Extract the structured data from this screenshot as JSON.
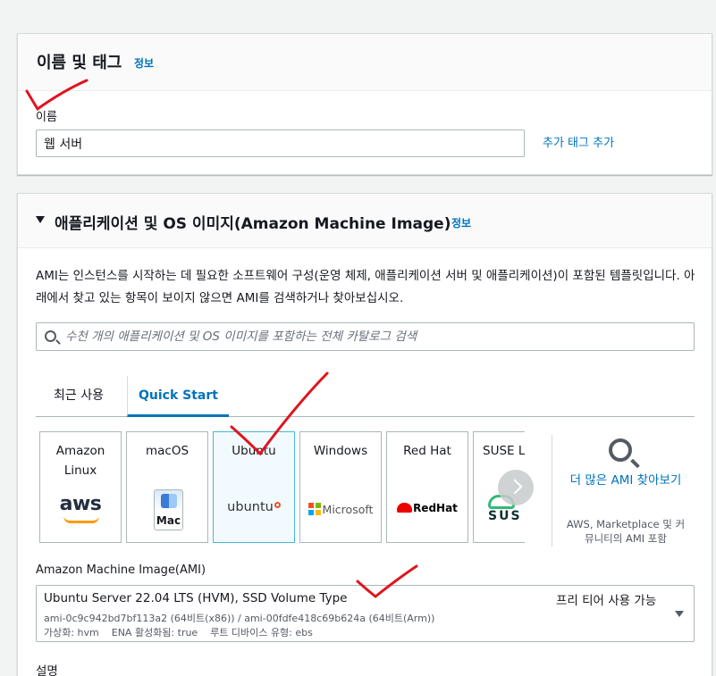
{
  "name_section": {
    "title": "이름 및 태그",
    "info": "정보",
    "name_label": "이름",
    "name_value": "웹 서버",
    "add_tag": "추가 태그 추가"
  },
  "ami_section": {
    "title": "애플리케이션 및 OS 이미지(Amazon Machine Image)",
    "info": "정보",
    "description": "AMI는 인스턴스를 시작하는 데 필요한 소프트웨어 구성(운영 체제, 애플리케이션 서버 및 애플리케이션)이 포함된 템플릿입니다. 아래에서 찾고 있는 항목이 보이지 않으면 AMI를 검색하거나 찾아보십시오.",
    "search_placeholder": "수천 개의 애플리케이션 및 OS 이미지를 포함하는 전체 카탈로그 검색",
    "tabs": [
      {
        "label": "최근 사용",
        "active": false
      },
      {
        "label": "Quick Start",
        "active": true
      }
    ],
    "os_options": [
      {
        "name": "Amazon Linux",
        "logo": "aws"
      },
      {
        "name": "macOS",
        "logo": "Mac"
      },
      {
        "name": "Ubuntu",
        "logo": "ubuntu",
        "selected": true
      },
      {
        "name": "Windows",
        "logo": "Microsoft"
      },
      {
        "name": "Red Hat",
        "logo": "RedHat"
      },
      {
        "name": "SUSE Li",
        "logo": "SUS"
      }
    ],
    "more_ami": {
      "link": "더 많은 AMI 찾아보기",
      "desc": "AWS, Marketplace 및 커뮤니티의 AMI 포함"
    },
    "ami_label": "Amazon Machine Image(AMI)",
    "selected_ami": {
      "title": "Ubuntu Server 22.04 LTS (HVM), SSD Volume Type",
      "ids": "ami-0c9c942bd7bf113a2 (64비트(x86)) / ami-00fdfe418c69b624a (64비트(Arm))",
      "details": "가상화: hvm    ENA 활성화됨: true    루트 디바이스 유형: ebs",
      "badge": "프리 티어 사용 가능"
    },
    "desc_label": "설명"
  },
  "colors": {
    "link": "#0073bb",
    "annotation": "#e0141e",
    "selected_card_bg": "#f1faff"
  }
}
